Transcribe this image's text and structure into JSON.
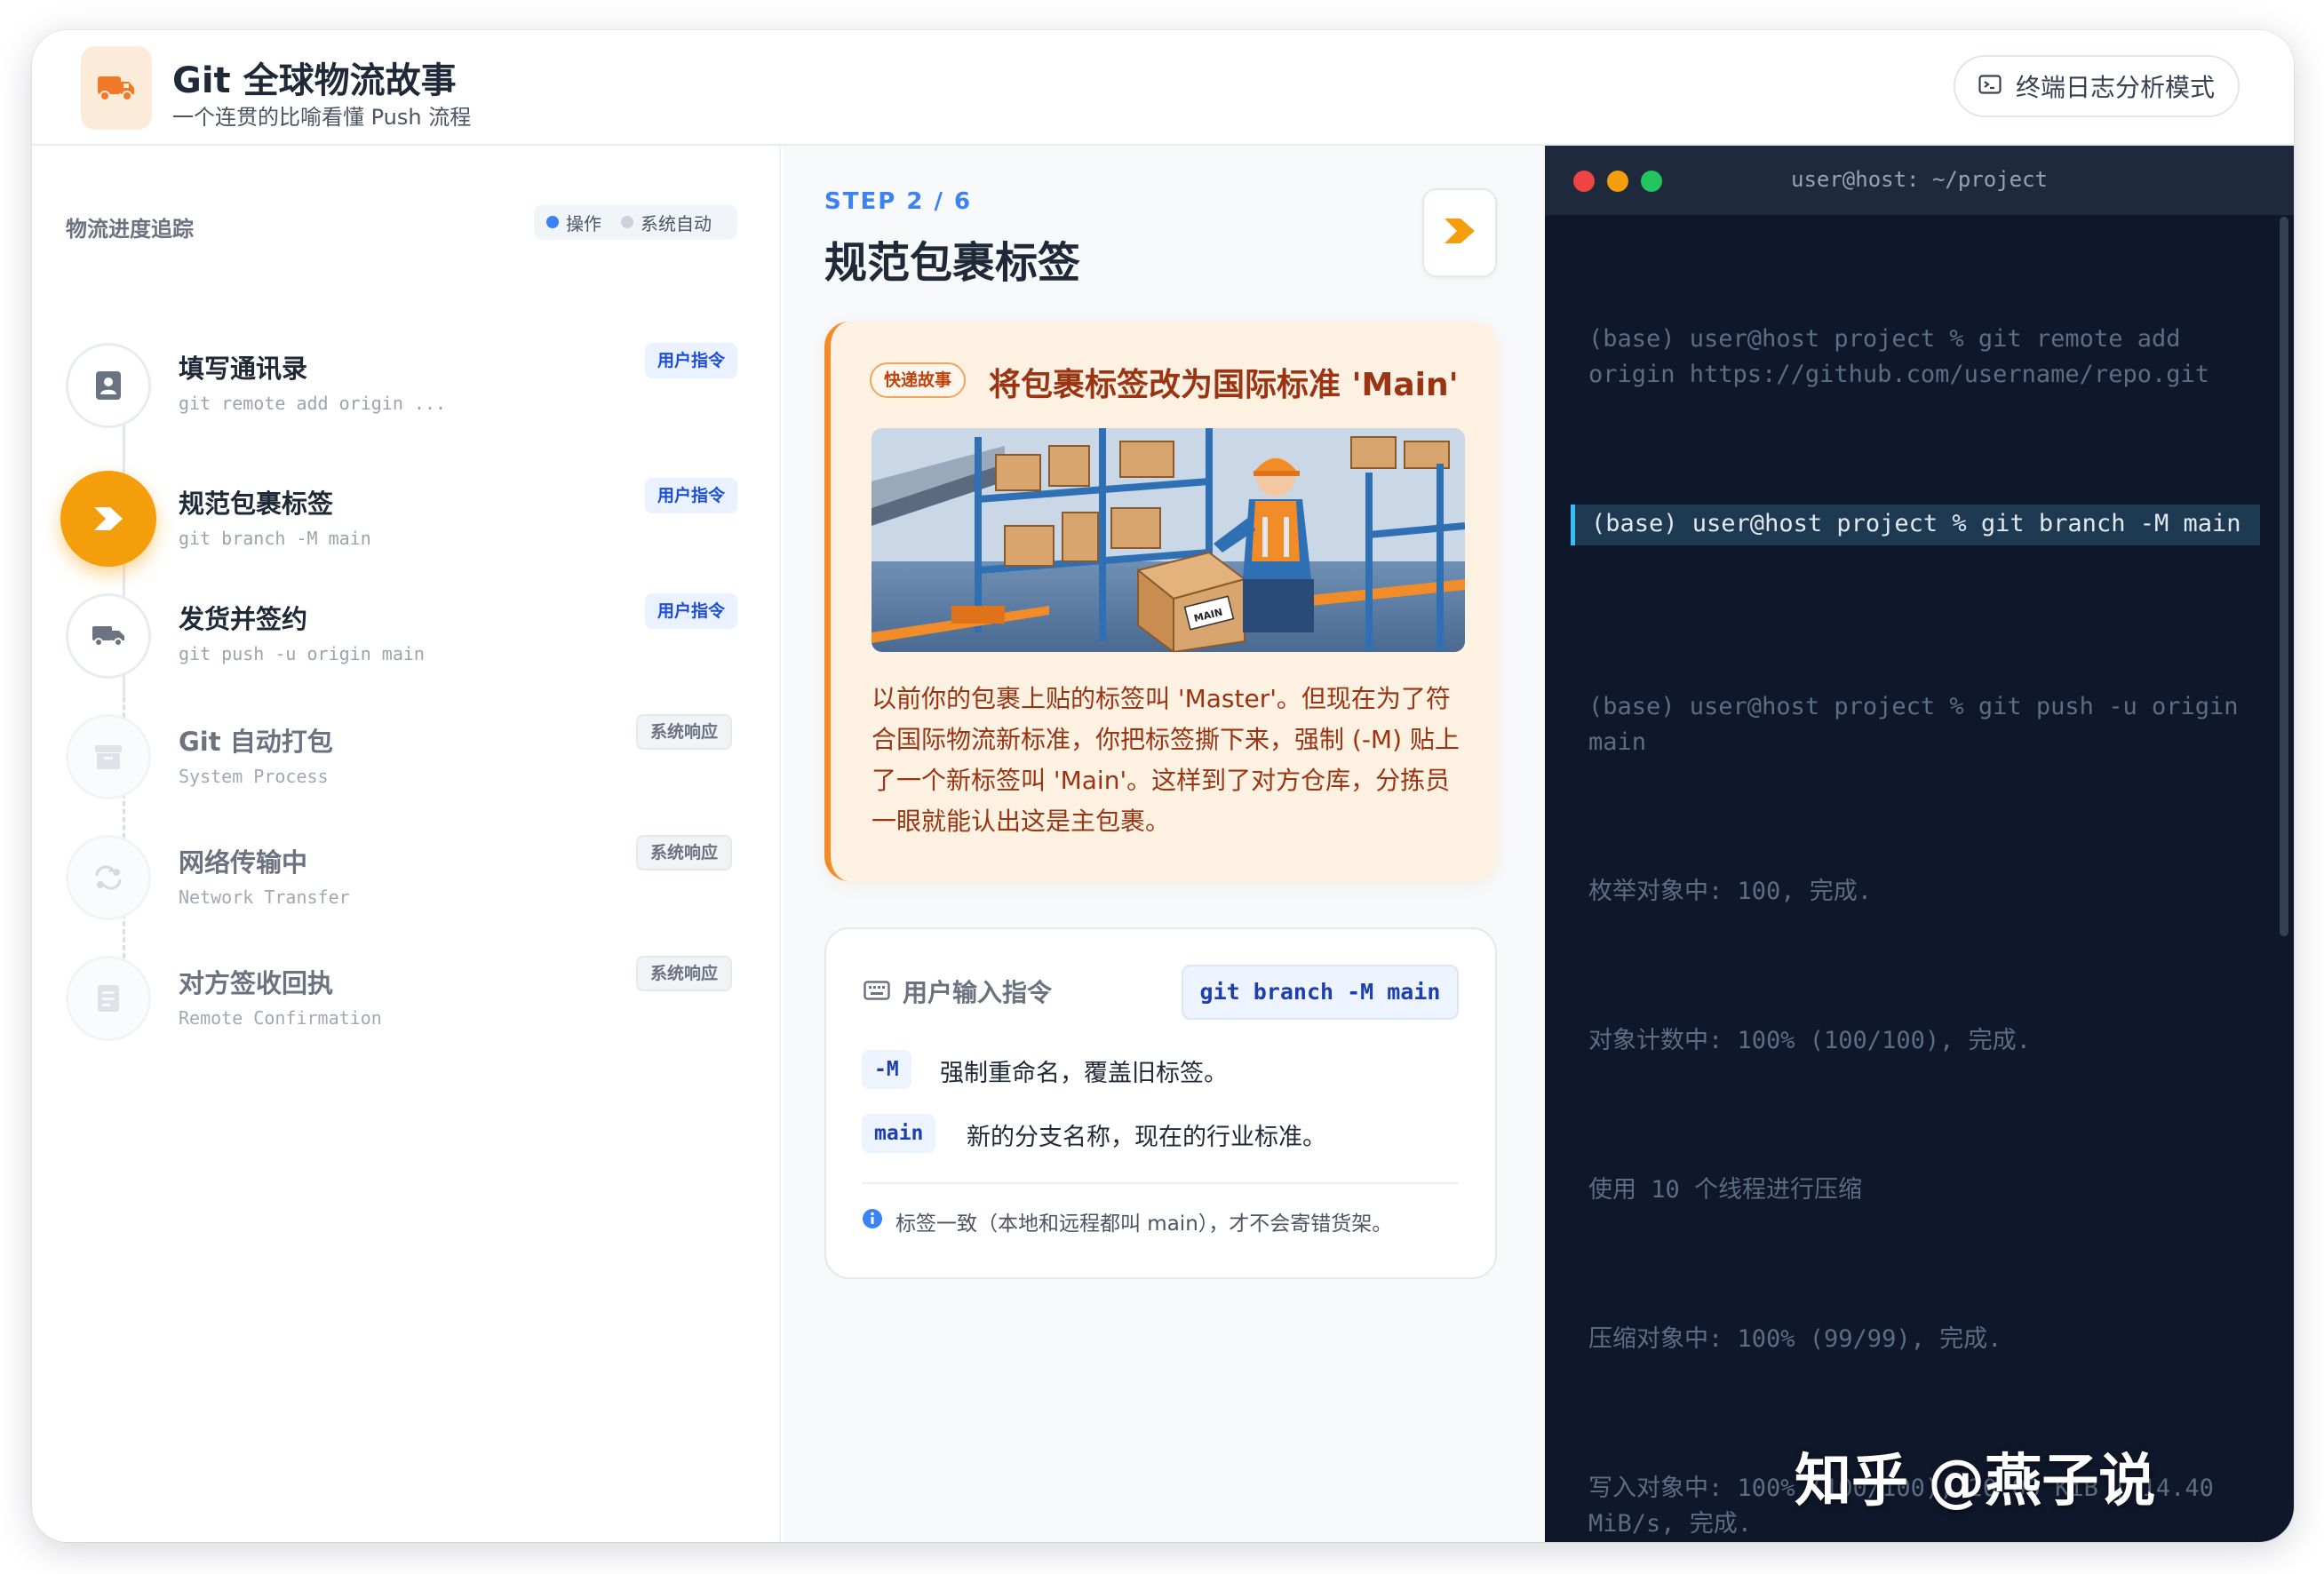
{
  "header": {
    "title": "Git 全球物流故事",
    "subtitle": "一个连贯的比喻看懂 Push 流程",
    "mode_button": "终端日志分析模式"
  },
  "sidebar": {
    "title": "物流进度追踪",
    "legend": {
      "user": "操作",
      "system": "系统自动"
    },
    "steps": [
      {
        "name": "填写通讯录",
        "cmd": "git remote add origin ...",
        "badge": "用户指令",
        "icon": "contact-card-icon"
      },
      {
        "name": "规范包裹标签",
        "cmd": "git branch -M main",
        "badge": "用户指令",
        "icon": "chevron-right-icon"
      },
      {
        "name": "发货并签约",
        "cmd": "git push -u origin main",
        "badge": "用户指令",
        "icon": "truck-icon"
      },
      {
        "name": "Git 自动打包",
        "cmd": "System Process",
        "badge": "系统响应",
        "icon": "archive-box-icon"
      },
      {
        "name": "网络传输中",
        "cmd": "Network Transfer",
        "badge": "系统响应",
        "icon": "transfer-icon"
      },
      {
        "name": "对方签收回执",
        "cmd": "Remote Confirmation",
        "badge": "系统响应",
        "icon": "receipt-icon"
      }
    ]
  },
  "main": {
    "step_label": "STEP 2 / 6",
    "step_title": "规范包裹标签",
    "story": {
      "badge": "快递故事",
      "title": "将包裹标签改为国际标准 'Main'",
      "text": "以前你的包裹上贴的标签叫 'Master'。但现在为了符合国际物流新标准，你把标签撕下来，强制 (-M) 贴上了一个新标签叫 'Main'。这样到了对方仓库，分拣员一眼就能认出这是主包裹。",
      "box_label": "MAIN"
    },
    "command": {
      "heading": "用户输入指令",
      "value": "git branch -M main",
      "args": [
        {
          "flag": "-M",
          "desc": "强制重命名，覆盖旧标签。"
        },
        {
          "flag": "main",
          "desc": "新的分支名称，现在的行业标准。"
        }
      ],
      "note": "标签一致（本地和远程都叫 main），才不会寄错货架。"
    }
  },
  "terminal": {
    "title": "user@host: ~/project",
    "lines": [
      "(base) user@host project % git remote add origin https://github.com/username/repo.git",
      "(base) user@host project % git branch -M main",
      "(base) user@host project % git push -u origin main",
      "枚举对象中: 100, 完成.",
      "对象计数中: 100% (100/100), 完成.",
      "使用 10 个线程进行压缩",
      "压缩对象中: 100% (99/99), 完成.",
      "写入对象中: 100% (100/100), 20.00 KiB | 14.40 MiB/s, 完成."
    ]
  },
  "watermark": "知乎 @燕子说",
  "colors": {
    "accent": "#f59e0b",
    "story_bg": "#fdf1e2",
    "user_badge": "#1d4ed8",
    "terminal_bg": "#0f172a"
  }
}
